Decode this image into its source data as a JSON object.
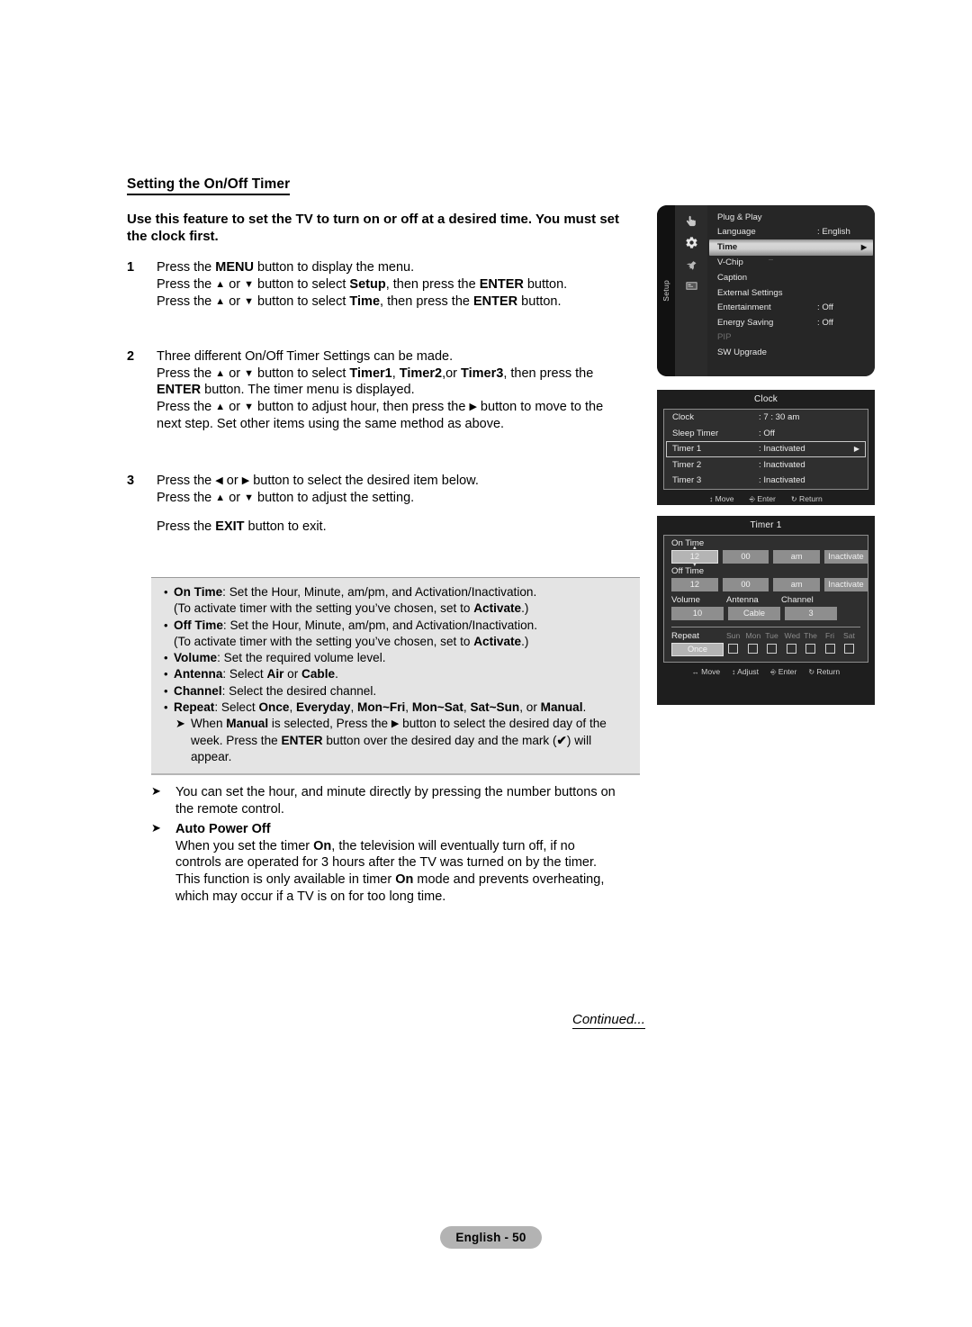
{
  "document": {
    "section_title": "Setting the On/Off Timer",
    "lead_paragraph": "Use this feature to set the TV to turn on or off at a desired time. You must set the clock first.",
    "continued": "Continued...",
    "page_badge": "English - 50"
  },
  "steps": [
    {
      "number": "1",
      "lines": [
        "Press the MENU button to display the menu.",
        "Press the ▲ or ▼ button to select Setup, then press the ENTER button.",
        "Press the ▲ or ▼ button to select Time, then press the ENTER button."
      ]
    },
    {
      "number": "2",
      "lines": [
        "Three different On/Off Timer Settings can be made.",
        "Press the ▲ or ▼ button to select Timer1, Timer2,or Timer3, then press the ENTER button. The timer menu is displayed.",
        "Press the ▲ or ▼ button to adjust hour, then press the ▶ button to move to the next step. Set other items using the same method as above."
      ]
    },
    {
      "number": "3",
      "lines": [
        "Press the ◀ or ▶ button to select the desired item below.",
        "Press the ▲ or ▼ button to adjust the setting.",
        "Press the EXIT button to exit."
      ]
    }
  ],
  "bullets": [
    {
      "term": "On Time",
      "rest": ": Set the Hour, Minute, am/pm, and Activation/Inactivation.",
      "second": "(To activate timer with the setting you’ve chosen, set to Activate.)"
    },
    {
      "term": "Off Time",
      "rest": ": Set the Hour, Minute, am/pm, and Activation/Inactivation.",
      "second": "(To activate timer with the setting you’ve chosen, set to Activate.)"
    },
    {
      "term": "Volume",
      "rest": ": Set the required volume level.",
      "second": ""
    },
    {
      "term": "Antenna",
      "rest": ": Select Air or Cable.",
      "second": ""
    },
    {
      "term": "Channel",
      "rest": ": Select the desired channel.",
      "second": ""
    },
    {
      "term": "Repeat",
      "rest": ": Select Once, Everyday, Mon~Fri, Mon~Sat, Sat~Sun, or Manual.",
      "second": ""
    }
  ],
  "sub_note": "When Manual is selected, Press the ▶ button to select the desired day of the week. Press the ENTER button over the desired day and the mark (✔) will appear.",
  "notes": [
    {
      "heading": "",
      "text": "You can set the hour, and minute directly by pressing the number buttons on the remote control."
    },
    {
      "heading": "Auto Power Off",
      "text": "When you set the timer On, the television will eventually turn off, if no controls are operated for 3 hours after the TV was turned on by the timer. This function is only available in timer On mode and prevents overheating, which may occur if a TV is on for too long time."
    }
  ],
  "osd_setup_menu": {
    "rail_label": "Setup",
    "icons": [
      "hand-pointer-icon",
      "gear-icon",
      "plug-icon",
      "tv-screen-icon"
    ],
    "items": [
      {
        "label": "Plug & Play",
        "value": "",
        "state": "normal"
      },
      {
        "label": "Language",
        "value": ": English",
        "state": "normal"
      },
      {
        "label": "Time",
        "value": "",
        "state": "highlighted"
      },
      {
        "label": "V-Chip",
        "value": "",
        "state": "normal"
      },
      {
        "label": "Caption",
        "value": "",
        "state": "normal"
      },
      {
        "label": "External Settings",
        "value": "",
        "state": "normal"
      },
      {
        "label": "Entertainment",
        "value": ": Off",
        "state": "normal"
      },
      {
        "label": "Energy Saving",
        "value": ": Off",
        "state": "normal"
      },
      {
        "label": "PIP",
        "value": "",
        "state": "dim"
      },
      {
        "label": "SW Upgrade",
        "value": "",
        "state": "normal"
      }
    ]
  },
  "osd_clock_menu": {
    "title": "Clock",
    "rows": [
      {
        "label": "Clock",
        "value": ": 7 : 30 am",
        "state": "normal"
      },
      {
        "label": "Sleep Timer",
        "value": ": Off",
        "state": "normal"
      },
      {
        "label": "Timer 1",
        "value": ": Inactivated",
        "state": "highlighted"
      },
      {
        "label": "Timer 2",
        "value": ": Inactivated",
        "state": "normal"
      },
      {
        "label": "Timer 3",
        "value": ": Inactivated",
        "state": "normal"
      }
    ],
    "footer": [
      {
        "glyph": "↕",
        "label": "Move"
      },
      {
        "glyph": "⏎",
        "label": "Enter"
      },
      {
        "glyph": "↺",
        "label": "Return"
      }
    ]
  },
  "osd_timer_menu": {
    "title": "Timer 1",
    "on_time": {
      "label": "On Time",
      "hour": "12",
      "minute": "00",
      "meridiem": "am",
      "activation": "Inactivate"
    },
    "off_time": {
      "label": "Off Time",
      "hour": "12",
      "minute": "00",
      "meridiem": "am",
      "activation": "Inactivate"
    },
    "volume": {
      "label": "Volume",
      "value": "10"
    },
    "antenna": {
      "label": "Antenna",
      "value": "Cable"
    },
    "channel": {
      "label": "Channel",
      "value": "3"
    },
    "repeat": {
      "label": "Repeat",
      "value": "Once"
    },
    "days": [
      "Sun",
      "Mon",
      "Tue",
      "Wed",
      "The",
      "Fri",
      "Sat"
    ],
    "footer": [
      {
        "glyph": "◀▶",
        "label": "Move"
      },
      {
        "glyph": "↕",
        "label": "Adjust"
      },
      {
        "glyph": "⏎",
        "label": "Enter"
      },
      {
        "glyph": "↺",
        "label": "Return"
      }
    ]
  }
}
